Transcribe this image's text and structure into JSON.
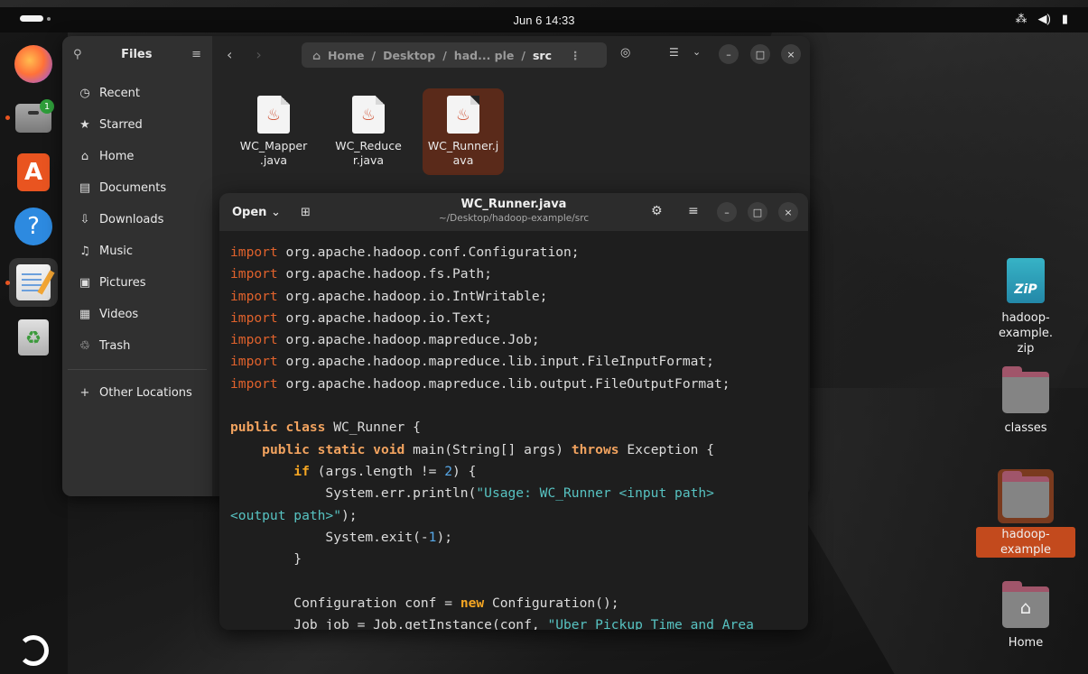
{
  "topbar": {
    "clock": "Jun 6  14:33",
    "tray_icons": [
      "network-icon",
      "volume-icon",
      "battery-icon"
    ]
  },
  "dock": {
    "items": [
      "Firefox",
      "Files",
      "App Center",
      "Help",
      "Text Editor",
      "Trash"
    ],
    "files_badge": "1"
  },
  "files": {
    "sidebar_title": "Files",
    "sidebar": [
      "Recent",
      "Starred",
      "Home",
      "Documents",
      "Downloads",
      "Music",
      "Pictures",
      "Videos",
      "Trash"
    ],
    "other_locations": "Other Locations",
    "path": {
      "home": "Home",
      "desktop": "Desktop",
      "project": "had... ple",
      "current": "src"
    },
    "items": [
      {
        "name": "WC_Mapper\n.java"
      },
      {
        "name": "WC_Reduce\nr.java"
      },
      {
        "name": "WC_Runner.j\nava"
      }
    ]
  },
  "editor": {
    "open_label": "Open",
    "title": "WC_Runner.java",
    "subtitle": "~/Desktop/hadoop-example/src"
  },
  "desktop": {
    "icons": [
      {
        "label": "hadoop-example.\nzip"
      },
      {
        "label": "classes"
      },
      {
        "label": "hadoop-example"
      },
      {
        "label": "Home"
      }
    ]
  },
  "colors": {
    "accent": "#e95420",
    "selection": "#5a2a1a",
    "keyword": "#f2a35f",
    "string": "#57c3c2"
  }
}
